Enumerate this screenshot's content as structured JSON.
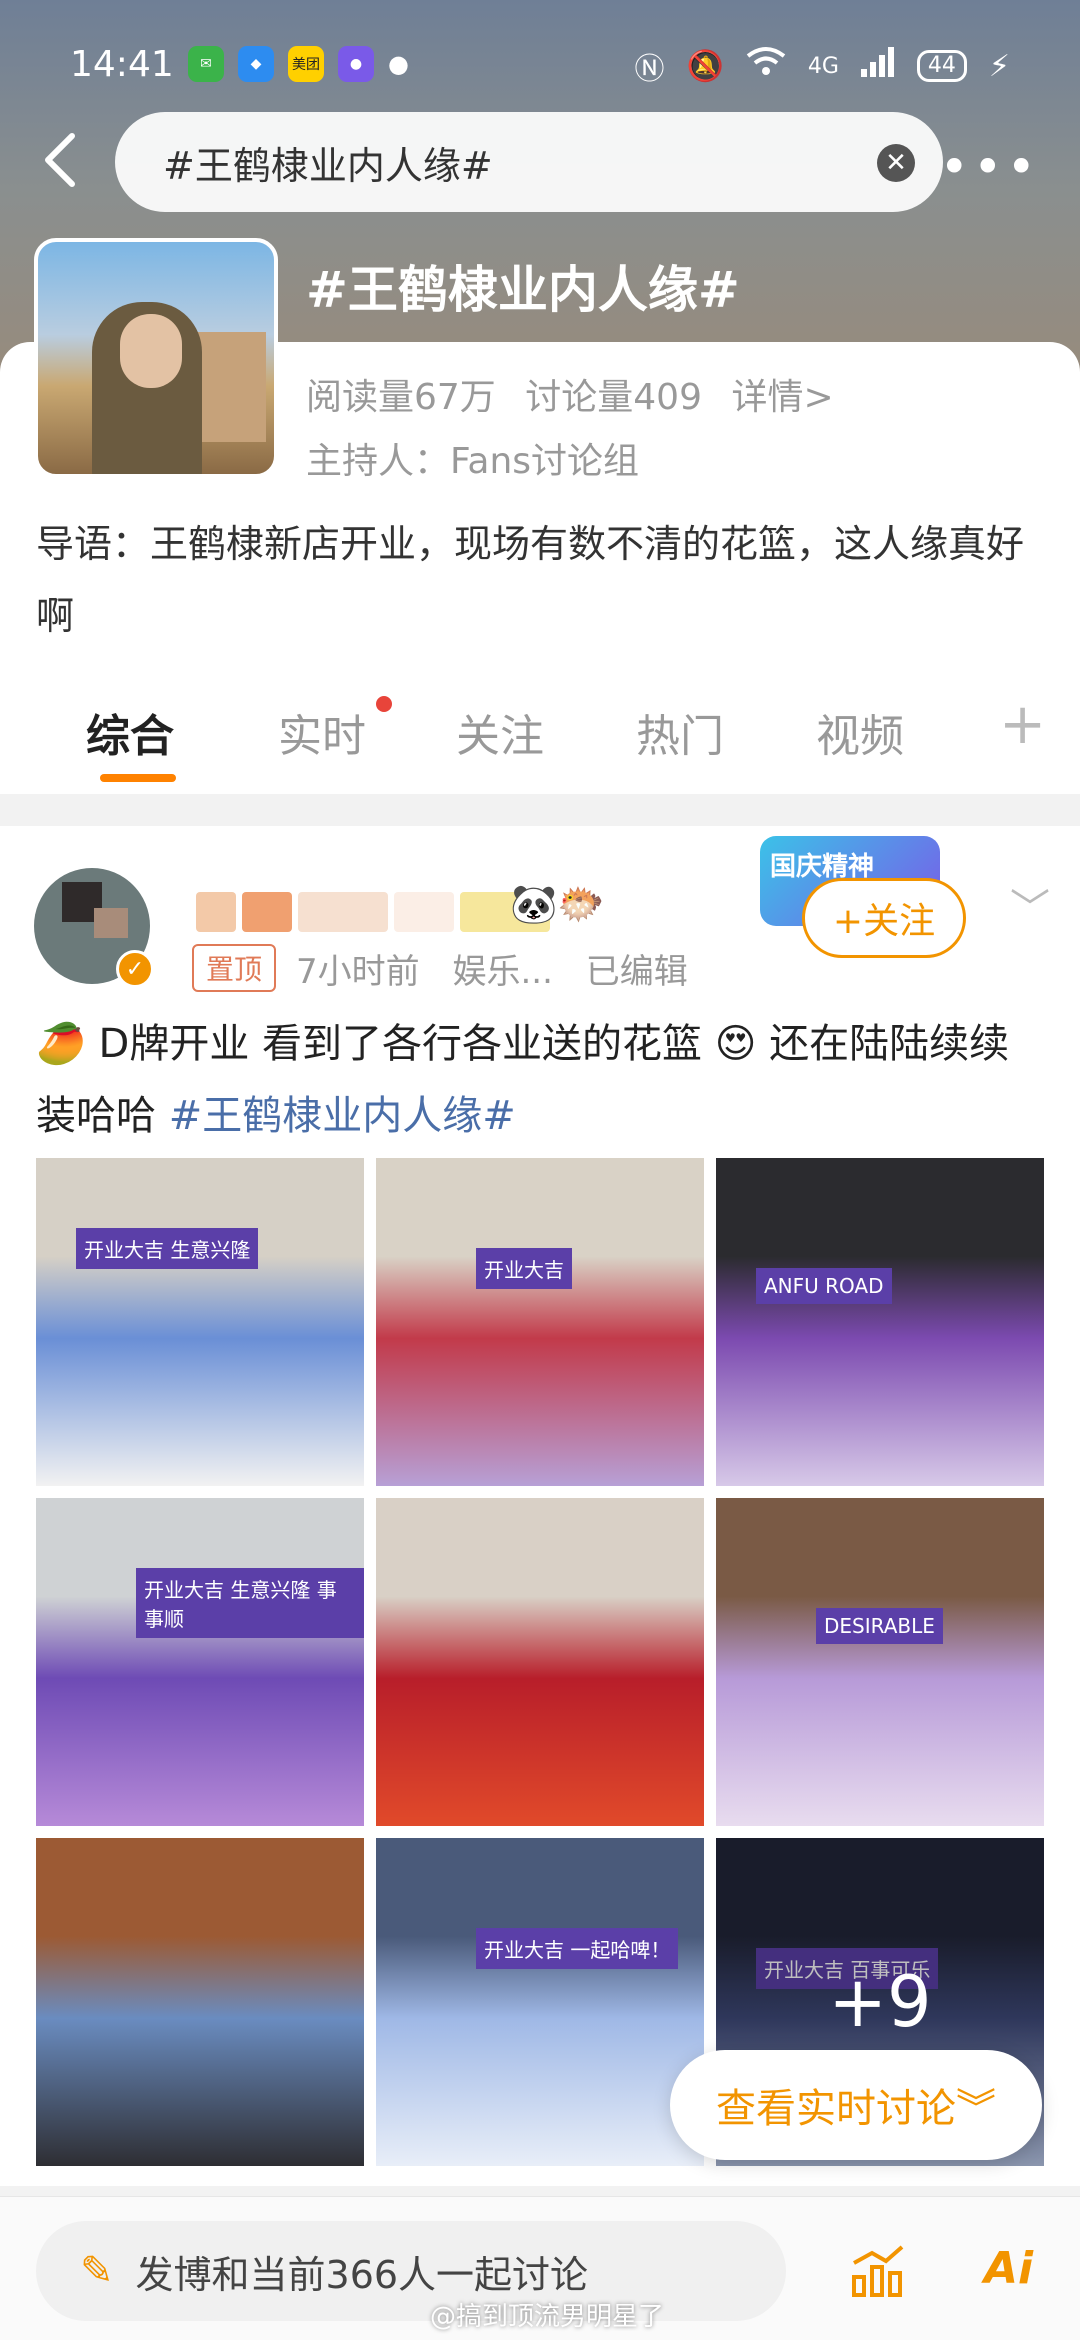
{
  "status": {
    "time": "14:41",
    "apps": [
      "messages",
      "browser",
      "美团",
      "games"
    ],
    "network": "4G",
    "battery": "44"
  },
  "search": {
    "value": "#王鹤棣业内人缘#",
    "clear_icon": "close-circle-icon"
  },
  "topic": {
    "title": "#王鹤棣业内人缘#",
    "reads": "阅读量67万",
    "discussions": "讨论量409",
    "details": "详情>",
    "host": "主持人：Fans讨论组",
    "intro": "导语：王鹤棣新店开业，现场有数不清的花篮，这人缘真好啊"
  },
  "tabs": [
    {
      "label": "综合"
    },
    {
      "label": "实时"
    },
    {
      "label": "关注"
    },
    {
      "label": "热门"
    },
    {
      "label": "视频"
    }
  ],
  "post": {
    "pin": "置顶",
    "time": "7小时前",
    "source": "娱乐...",
    "edited": "已编辑",
    "promo": "国庆精神",
    "follow": "+关注",
    "text_main": "D牌开业  看到了各行各业送的花篮",
    "text_tail": " 还在陆陆续续装哈哈 ",
    "hashtag": "#王鹤棣业内人缘#",
    "more_count": "+9",
    "images": [
      {
        "sign": "开业大吉 生意兴隆",
        "colors": [
          "#d6d0c6",
          "#6a8fd6",
          "#f2f2f2"
        ]
      },
      {
        "sign": "开业大吉",
        "colors": [
          "#d9d2c6",
          "#c23a4a",
          "#b7a0d6"
        ]
      },
      {
        "sign": "ANFU ROAD",
        "colors": [
          "#2b2b2f",
          "#7c4ab0",
          "#d7c9e8"
        ]
      },
      {
        "sign": "开业大吉 生意兴隆 事事顺",
        "colors": [
          "#cfd2d4",
          "#6e4bb5",
          "#b68ad8"
        ]
      },
      {
        "sign": "",
        "colors": [
          "#d9d0c6",
          "#b81e2a",
          "#e14a2a"
        ]
      },
      {
        "sign": "DESIRABLE",
        "colors": [
          "#7a5a45",
          "#b79ad8",
          "#e8dcef"
        ]
      },
      {
        "sign": "",
        "colors": [
          "#9c5a34",
          "#6a8cc0",
          "#2e2e33"
        ]
      },
      {
        "sign": "开业大吉 一起哈啤！",
        "colors": [
          "#4a5a7a",
          "#9fb8e6",
          "#e8eef8"
        ]
      },
      {
        "sign": "开业大吉 百事可乐",
        "colors": [
          "#22263a",
          "#3f4a7a",
          "#b9c8e8"
        ]
      }
    ]
  },
  "live_button": "查看实时讨论",
  "compose": {
    "placeholder": "发博和当前366人一起讨论"
  },
  "watermark": "@搞到顶流男明星了",
  "colors": {
    "accent": "#f29400",
    "hashtag": "#4a6ea8",
    "active_tab_underline": "#ff8200"
  }
}
